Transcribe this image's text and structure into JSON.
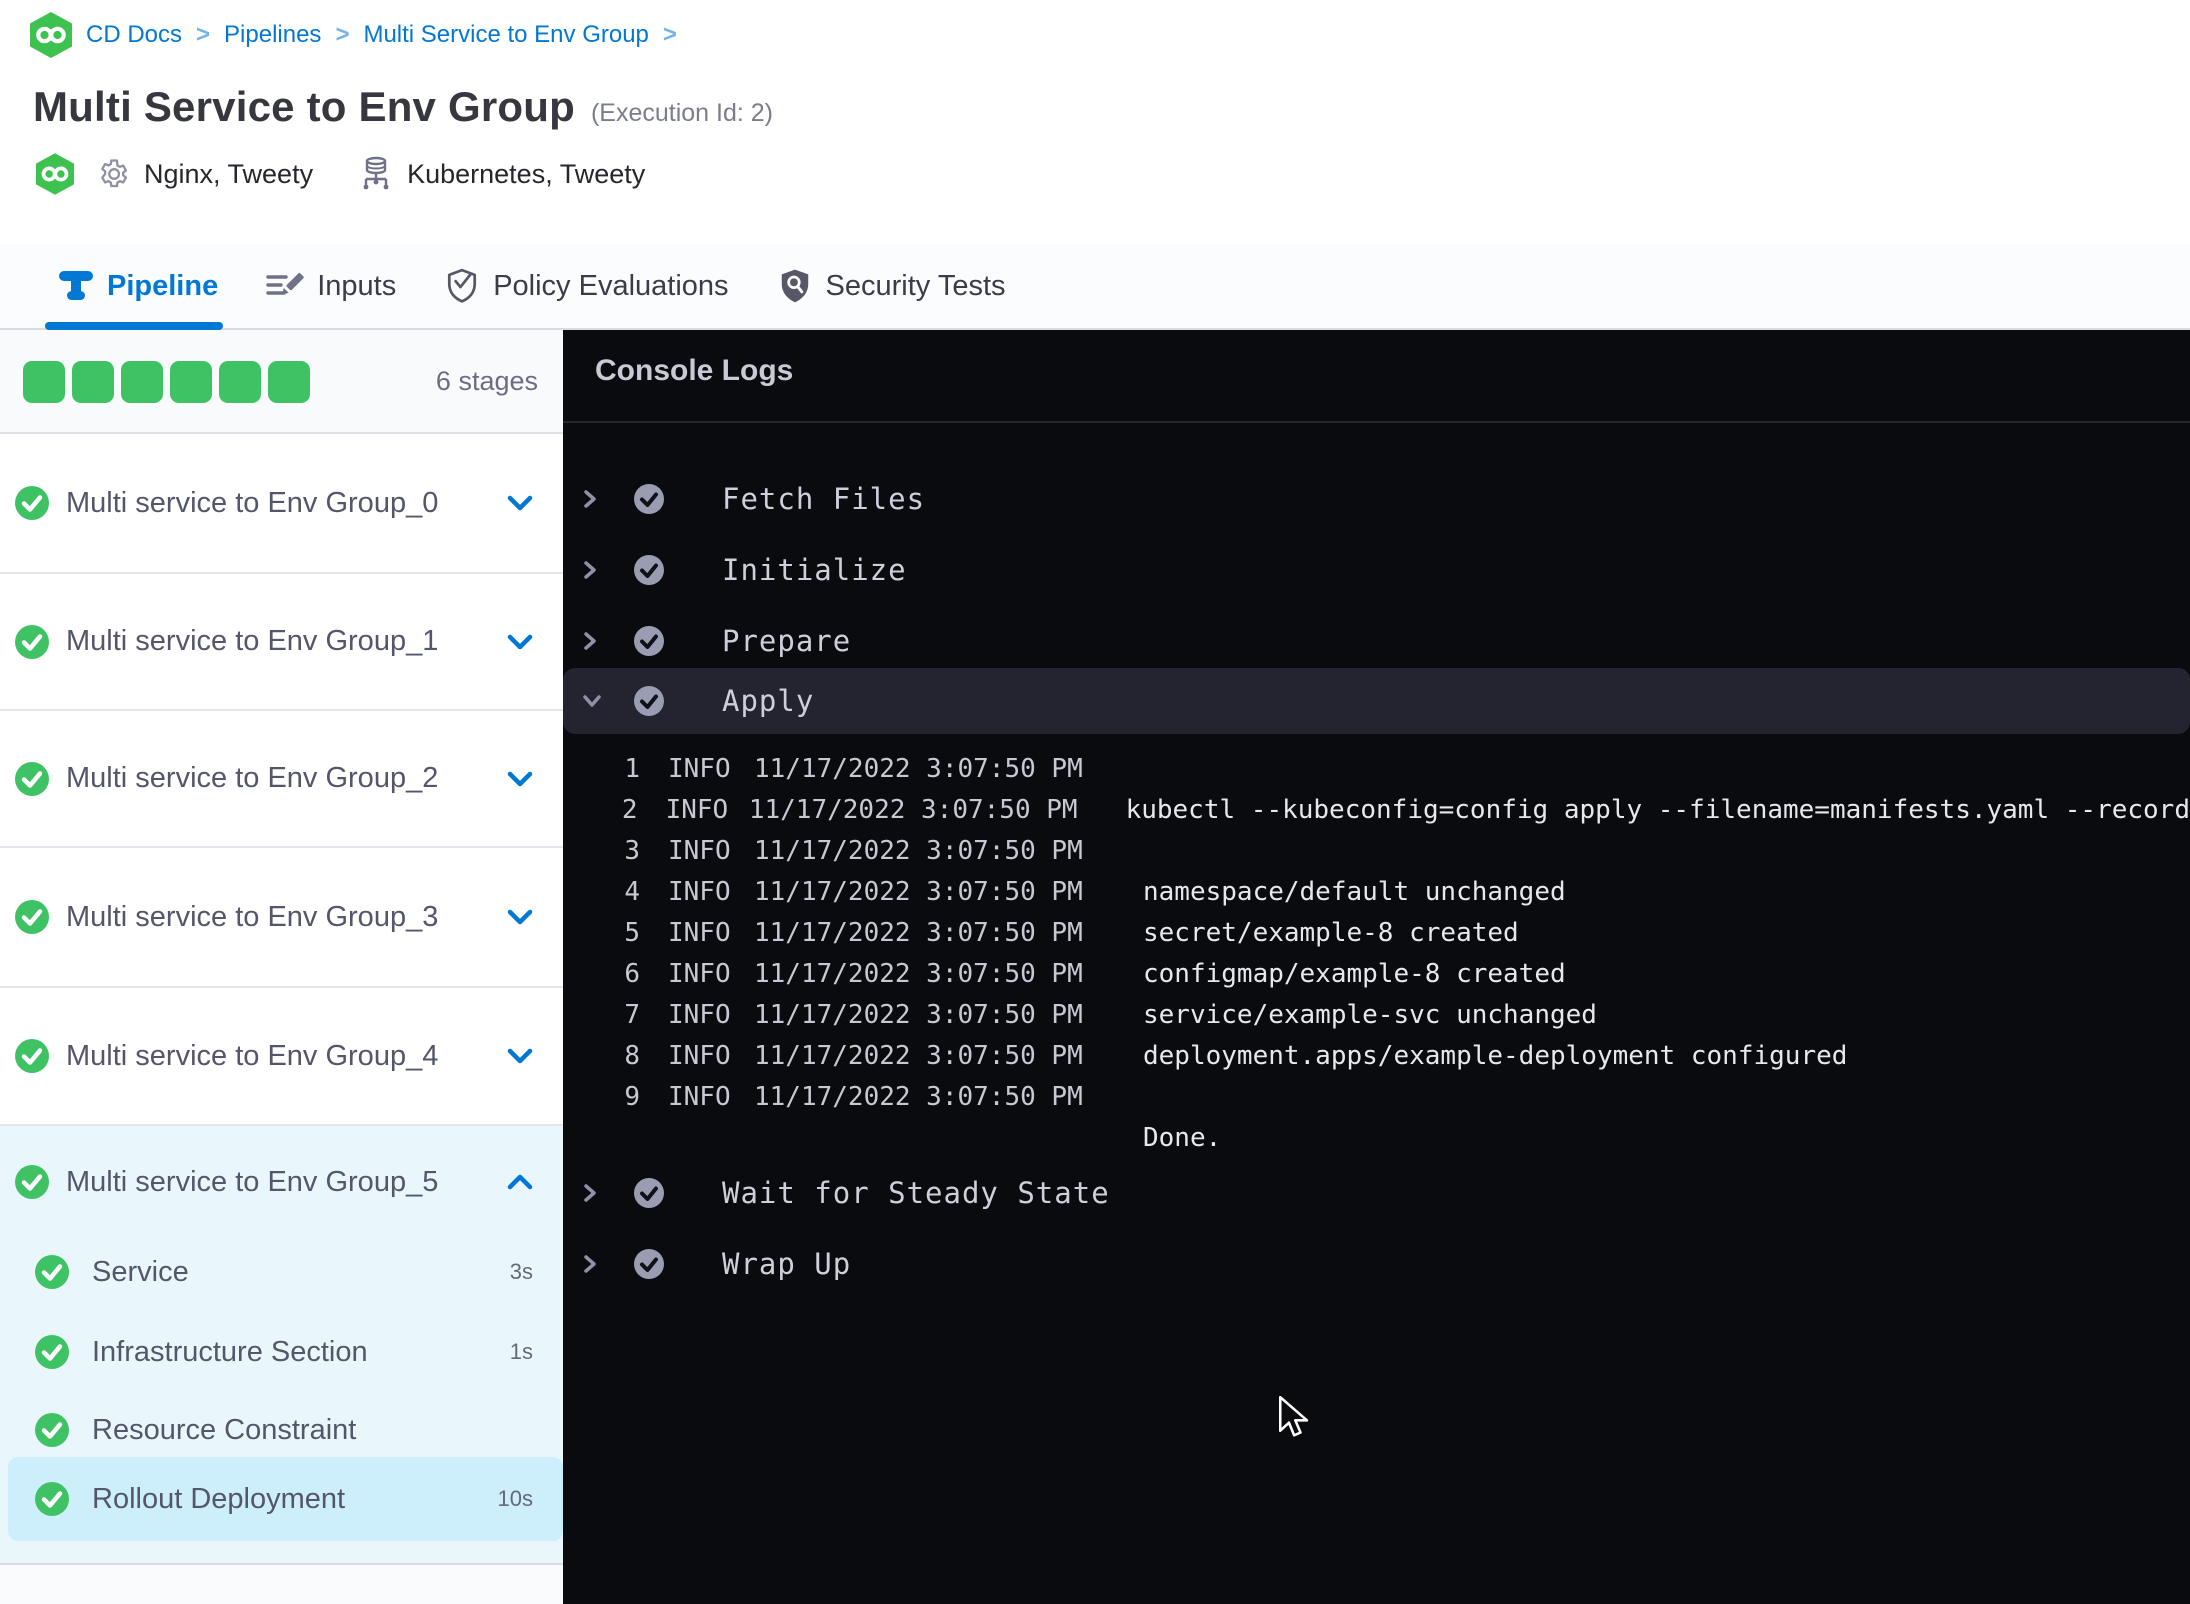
{
  "breadcrumb": {
    "separator": ">",
    "items": [
      "CD Docs",
      "Pipelines",
      "Multi Service to Env Group"
    ]
  },
  "header": {
    "title": "Multi Service to Env Group",
    "execution_id": "(Execution Id: 2)",
    "services_label": "Nginx, Tweety",
    "environments_label": "Kubernetes, Tweety"
  },
  "tabs": [
    {
      "label": "Pipeline",
      "active": true
    },
    {
      "label": "Inputs",
      "active": false
    },
    {
      "label": "Policy Evaluations",
      "active": false
    },
    {
      "label": "Security Tests",
      "active": false
    }
  ],
  "stages": {
    "count_label": "6 stages",
    "squares": 6,
    "rows": [
      {
        "name": "Multi service to Env Group_0",
        "status": "success"
      },
      {
        "name": "Multi service to Env Group_1",
        "status": "success"
      },
      {
        "name": "Multi service to Env Group_2",
        "status": "success"
      },
      {
        "name": "Multi service to Env Group_3",
        "status": "success"
      },
      {
        "name": "Multi service to Env Group_4",
        "status": "success"
      }
    ],
    "expanded": {
      "name": "Multi service to Env Group_5",
      "status": "success",
      "children": [
        {
          "name": "Service",
          "duration": "3s",
          "status": "success",
          "selected": false
        },
        {
          "name": "Infrastructure Section",
          "duration": "1s",
          "status": "success",
          "selected": false
        },
        {
          "name": "Resource Constraint",
          "duration": "",
          "status": "success",
          "selected": false
        },
        {
          "name": "Rollout Deployment",
          "duration": "10s",
          "status": "success",
          "selected": true
        }
      ]
    }
  },
  "console": {
    "title": "Console Logs",
    "steps": [
      {
        "label": "Fetch Files",
        "state": "collapsed",
        "status": "success"
      },
      {
        "label": "Initialize",
        "state": "collapsed",
        "status": "success"
      },
      {
        "label": "Prepare",
        "state": "collapsed",
        "status": "success"
      },
      {
        "label": "Apply",
        "state": "expanded",
        "status": "success"
      },
      {
        "label": "Wait for Steady State",
        "state": "collapsed",
        "status": "success"
      },
      {
        "label": "Wrap Up",
        "state": "collapsed",
        "status": "success"
      }
    ],
    "log_lines": [
      {
        "num": "1",
        "level": "INFO",
        "timestamp": "11/17/2022 3:07:50 PM",
        "message": ""
      },
      {
        "num": "2",
        "level": "INFO",
        "timestamp": "11/17/2022 3:07:50 PM",
        "message": "kubectl --kubeconfig=config apply --filename=manifests.yaml --record"
      },
      {
        "num": "3",
        "level": "INFO",
        "timestamp": "11/17/2022 3:07:50 PM",
        "message": ""
      },
      {
        "num": "4",
        "level": "INFO",
        "timestamp": "11/17/2022 3:07:50 PM",
        "message": "namespace/default unchanged"
      },
      {
        "num": "5",
        "level": "INFO",
        "timestamp": "11/17/2022 3:07:50 PM",
        "message": "secret/example-8 created"
      },
      {
        "num": "6",
        "level": "INFO",
        "timestamp": "11/17/2022 3:07:50 PM",
        "message": "configmap/example-8 created"
      },
      {
        "num": "7",
        "level": "INFO",
        "timestamp": "11/17/2022 3:07:50 PM",
        "message": "service/example-svc unchanged"
      },
      {
        "num": "8",
        "level": "INFO",
        "timestamp": "11/17/2022 3:07:50 PM",
        "message": "deployment.apps/example-deployment configured"
      },
      {
        "num": "9",
        "level": "INFO",
        "timestamp": "11/17/2022 3:07:50 PM",
        "message": ""
      },
      {
        "num": "",
        "level": "",
        "timestamp": "",
        "message": "Done."
      }
    ]
  },
  "colors": {
    "accent_blue": "#0278d5",
    "success_green": "#3ec264",
    "expanded_bg": "#e9f7fd",
    "selected_row_bg": "#cdeefb",
    "console_bg": "#0a0b0e"
  }
}
